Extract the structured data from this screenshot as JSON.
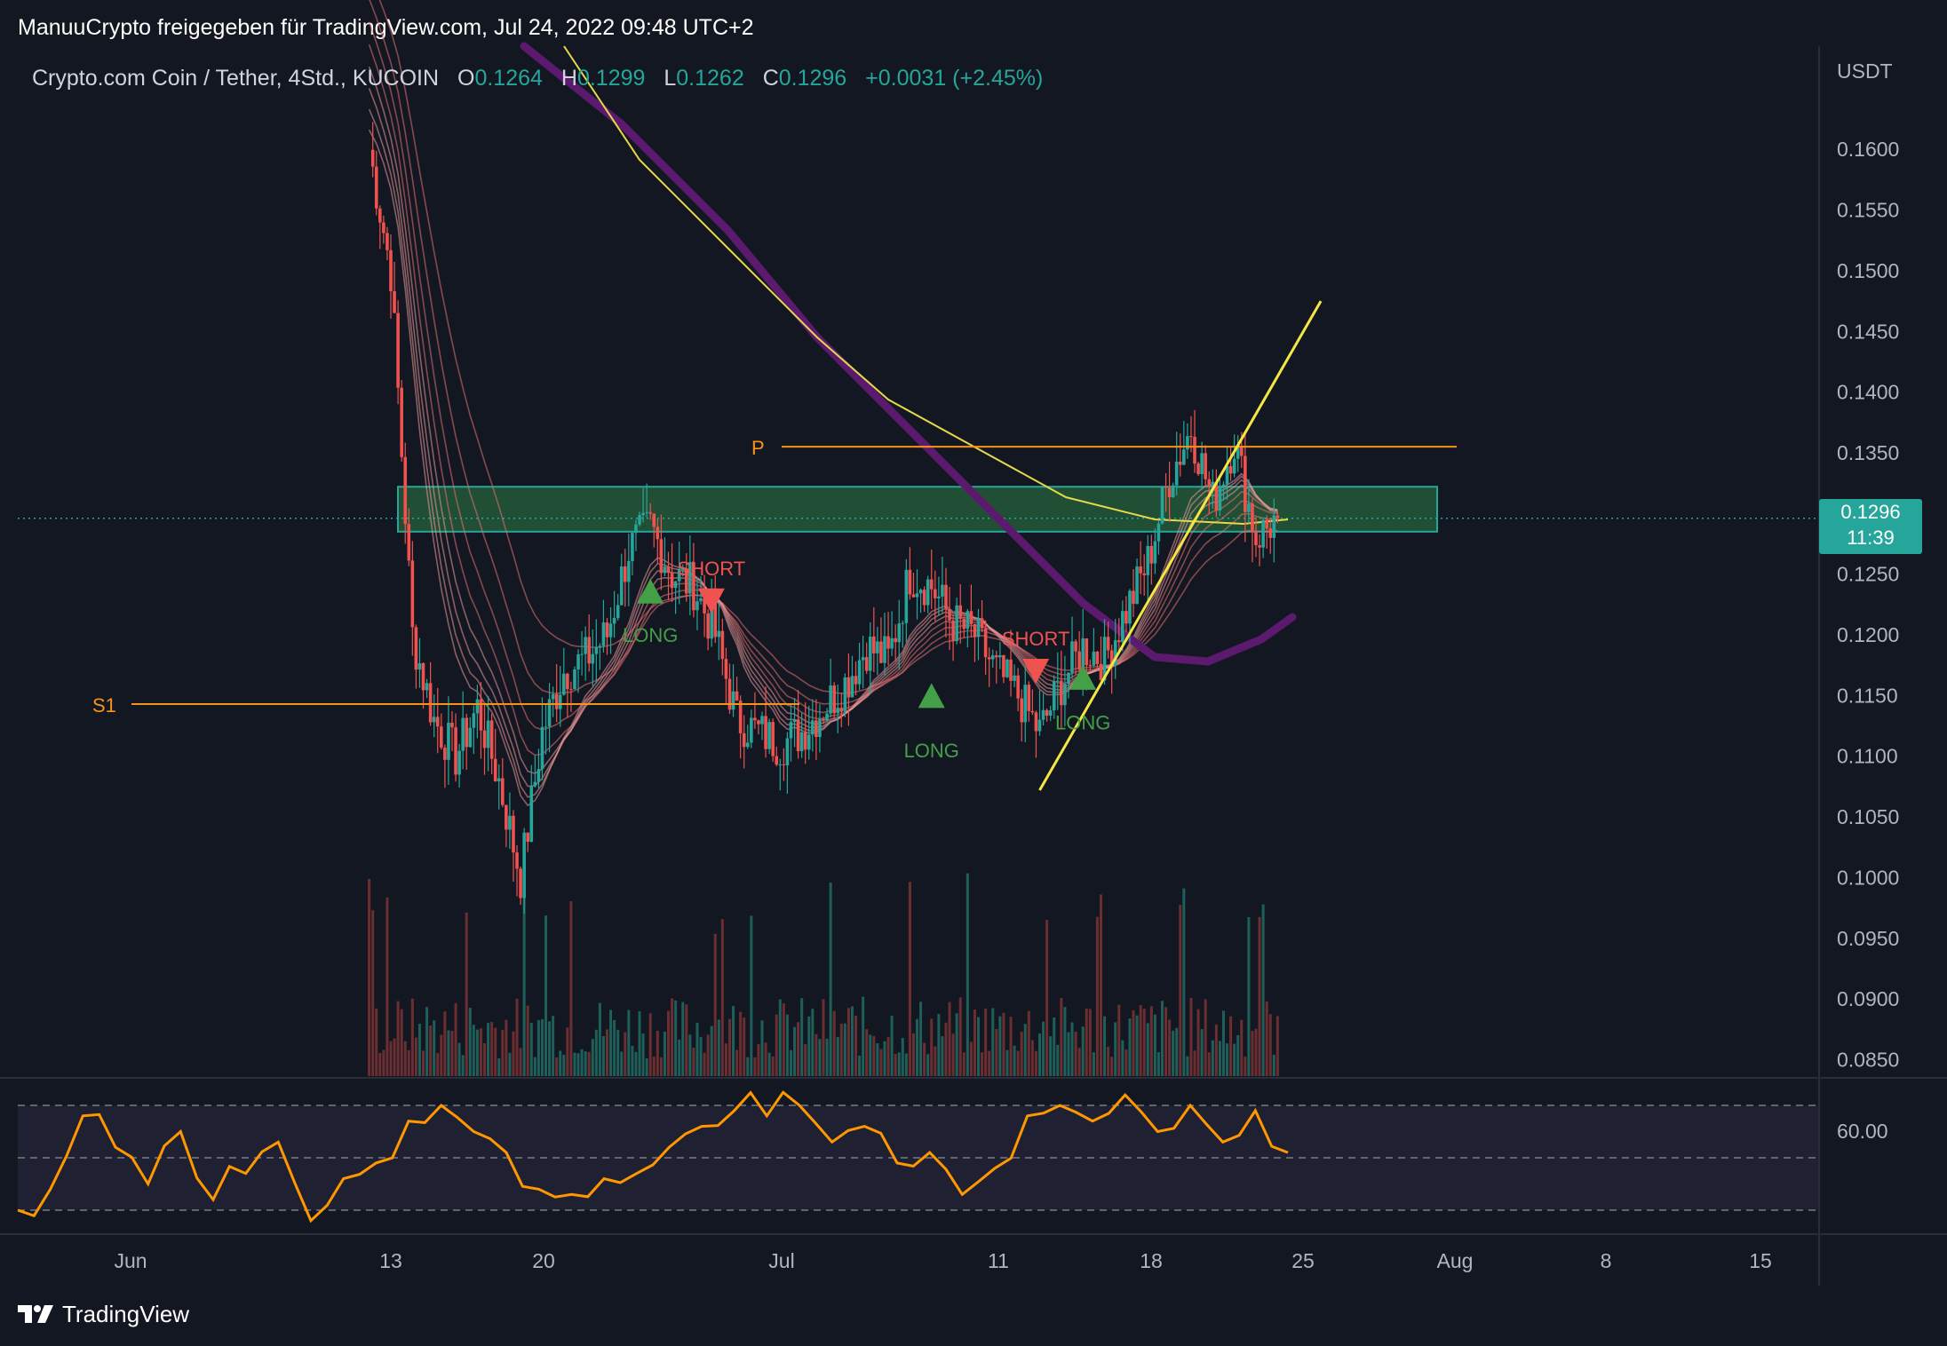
{
  "header": {
    "title": "ManuuCrypto freigegeben für TradingView.com, Jul 24, 2022 09:48 UTC+2"
  },
  "symbol": {
    "name": "Crypto.com Coin / Tether, 4Std., KUCOIN",
    "open_label": "O",
    "open": "0.1264",
    "high_label": "H",
    "high": "0.1299",
    "low_label": "L",
    "low": "0.1262",
    "close_label": "C",
    "close": "0.1296",
    "change": "+0.0031 (+2.45%)"
  },
  "price_axis": {
    "currency": "USDT",
    "last_price": "0.1296",
    "countdown": "11:39"
  },
  "brand": {
    "name": "TradingView"
  },
  "colors": {
    "background": "#131722",
    "up": "#26a69a",
    "down": "#ef5350",
    "ema_purple": "#5b1a6e",
    "ema_yellow": "#e6d84a",
    "pivot": "#f7931a",
    "rsi": "#ff9800",
    "zone": "#2e7d46",
    "trendline": "#f5e642"
  },
  "chart_data": {
    "type": "line",
    "title": "",
    "xlabel": "",
    "ylabel": "",
    "ylim": [
      0.0835,
      0.1685
    ],
    "yticks": [
      "0.1600",
      "0.1550",
      "0.1500",
      "0.1450",
      "0.1400",
      "0.1350",
      "0.1250",
      "0.1200",
      "0.1150",
      "0.1100",
      "0.1050",
      "0.1000",
      "0.0950",
      "0.0900",
      "0.0850"
    ],
    "xticks": [
      "Jun",
      "13",
      "20",
      "Jul",
      "11",
      "18",
      "25",
      "Aug",
      "8",
      "15"
    ],
    "series": [
      {
        "x": [
          "Jun 12",
          "Jun 13",
          "Jun 14",
          "Jun 15",
          "Jun 16",
          "Jun 17",
          "Jun 18",
          "Jun 19",
          "Jun 20",
          "Jun 21",
          "Jun 22",
          "Jun 23",
          "Jun 24",
          "Jun 25",
          "Jun 26",
          "Jun 27",
          "Jun 28",
          "Jun 29",
          "Jun 30",
          "Jul 1",
          "Jul 2",
          "Jul 3",
          "Jul 4",
          "Jul 5",
          "Jul 6",
          "Jul 7",
          "Jul 8",
          "Jul 9",
          "Jul 10",
          "Jul 11",
          "Jul 12",
          "Jul 13",
          "Jul 14",
          "Jul 15",
          "Jul 16",
          "Jul 17",
          "Jul 18",
          "Jul 19",
          "Jul 20",
          "Jul 21",
          "Jul 22",
          "Jul 23",
          "Jul 24"
        ],
        "values": [
          0.16,
          0.15,
          0.12,
          0.113,
          0.11,
          0.114,
          0.108,
          0.1,
          0.112,
          0.117,
          0.118,
          0.12,
          0.127,
          0.129,
          0.125,
          0.124,
          0.12,
          0.113,
          0.112,
          0.111,
          0.112,
          0.114,
          0.116,
          0.119,
          0.118,
          0.125,
          0.124,
          0.121,
          0.12,
          0.117,
          0.115,
          0.112,
          0.116,
          0.119,
          0.118,
          0.122,
          0.126,
          0.133,
          0.137,
          0.131,
          0.136,
          0.128,
          0.1296
        ]
      }
    ],
    "annotations": {
      "zone": {
        "from": 0.1285,
        "to": 0.1322
      },
      "pivot_p": {
        "label": "P",
        "value": 0.1355
      },
      "pivot_s1": {
        "label": "S1",
        "value": 0.1143
      },
      "trendline": {
        "from": [
          "Jul 13",
          0.1072
        ],
        "to": [
          "Jul 26",
          0.1475
        ]
      },
      "signals": [
        {
          "label": "LONG",
          "date": "Jun 25",
          "side": "long"
        },
        {
          "label": "SHORT",
          "date": "Jun 27",
          "side": "short"
        },
        {
          "label": "LONG",
          "date": "Jul 8",
          "side": "long"
        },
        {
          "label": "SHORT",
          "date": "Jul 12",
          "side": "short"
        },
        {
          "label": "LONG",
          "date": "Jul 15",
          "side": "long"
        }
      ]
    },
    "rsi": {
      "ytick": "60.00",
      "values": [
        40,
        44,
        58,
        52,
        45,
        55,
        42,
        47,
        53,
        38,
        46,
        49,
        57,
        60,
        55,
        51,
        44,
        43,
        46,
        47,
        52,
        56,
        59,
        58,
        60,
        53,
        56,
        49,
        51,
        43,
        48,
        58,
        60,
        57,
        62,
        55,
        60,
        53,
        59,
        51
      ]
    },
    "legend": "none",
    "grid": false
  }
}
